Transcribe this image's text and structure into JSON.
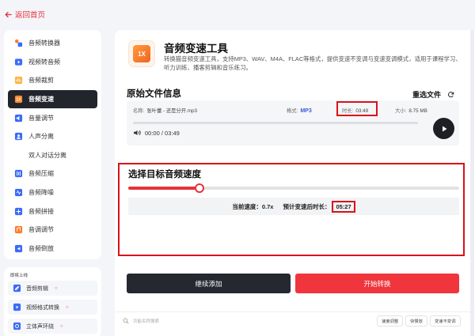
{
  "topbar": {
    "back_label": "返回首页"
  },
  "sidebar": {
    "items": [
      {
        "label": "音频转换器",
        "icon": "audio-convert-icon",
        "color": "#ff7a29"
      },
      {
        "label": "视频转音频",
        "icon": "video-audio-icon",
        "color": "#3b6cf6"
      },
      {
        "label": "音频裁剪",
        "icon": "audio-cut-icon",
        "color": "#ff9a2e"
      },
      {
        "label": "音频变速",
        "icon": "speed-icon",
        "color": "#ff8a30",
        "active": true
      },
      {
        "label": "音量调节",
        "icon": "volume-icon",
        "color": "#3b6cf6"
      },
      {
        "label": "人声分离",
        "icon": "voice-split-icon",
        "color": "#3b6cf6"
      },
      {
        "label": "双人对话分离",
        "icon": "dialog-split-icon",
        "color": "#ffffff"
      },
      {
        "label": "音频压缩",
        "icon": "compress-icon",
        "color": "#3b6cf6"
      },
      {
        "label": "音频降噪",
        "icon": "denoise-icon",
        "color": "#3b6cf6"
      },
      {
        "label": "音频拼接",
        "icon": "merge-icon",
        "color": "#3b6cf6"
      },
      {
        "label": "音调调节",
        "icon": "pitch-icon",
        "color": "#ff7a29"
      },
      {
        "label": "音频倒放",
        "icon": "reverse-icon",
        "color": "#3b6cf6"
      }
    ]
  },
  "side2": {
    "title": "即将上线",
    "items": [
      {
        "label": "音频剪辑",
        "icon": "audio-edit-icon"
      },
      {
        "label": "视频格式转换",
        "icon": "video-format-icon"
      },
      {
        "label": "立体声环绕",
        "icon": "stereo-icon"
      }
    ]
  },
  "tool": {
    "icon_text": "1X",
    "title": "音频变速工具",
    "description": "转换猫音频变速工具，支持MP3、WAV、M4A、FLAC等格式，提供变速不变调与变速变调模式，适用于课程学习、听力训练、播客剪辑和音乐练习。"
  },
  "original": {
    "section_title": "原始文件信息",
    "reselect_label": "重选文件",
    "name_label": "名称:",
    "name_value": "张叶蕾 - 还是分开.mp3",
    "format_label": "格式:",
    "format_value": "MP3",
    "duration_label": "时长:",
    "duration_value": "03:49",
    "size_label": "大小:",
    "size_value": "8.75 MB",
    "time_display": "00:00 / 03:49"
  },
  "speed": {
    "section_title": "选择目标音频速度",
    "slider_fraction": 0.215,
    "current_label": "当前速度：",
    "current_value": "0.7x",
    "new_label": "预计变速后时长：",
    "new_value": "05:27"
  },
  "actions": {
    "add_label": "继续添加",
    "start_label": "开始转换"
  },
  "footer": {
    "search_placeholder": "功能名称搜索",
    "chips": [
      "速度调整",
      "快慢放",
      "变速不变调"
    ]
  },
  "colors": {
    "accent": "#e6323c",
    "dark": "#23252c",
    "highlight": "#d9111a"
  }
}
